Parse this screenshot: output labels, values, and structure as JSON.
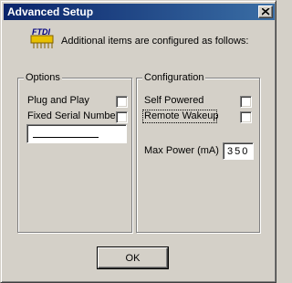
{
  "window": {
    "title": "Advanced Setup"
  },
  "header": {
    "logo_text": "FTDI",
    "intro": "Additional items are configured as follows:"
  },
  "options": {
    "label": "Options",
    "plug_and_play_label": "Plug and Play",
    "fixed_serial_label": "Fixed Serial Number",
    "serial_value": ""
  },
  "configuration": {
    "label": "Configuration",
    "self_powered_label": "Self Powered",
    "remote_wakeup_label": "Remote Wakeup",
    "max_power_label": "Max Power (mA)",
    "max_power_value": "350"
  },
  "footer": {
    "ok_label": "OK"
  }
}
